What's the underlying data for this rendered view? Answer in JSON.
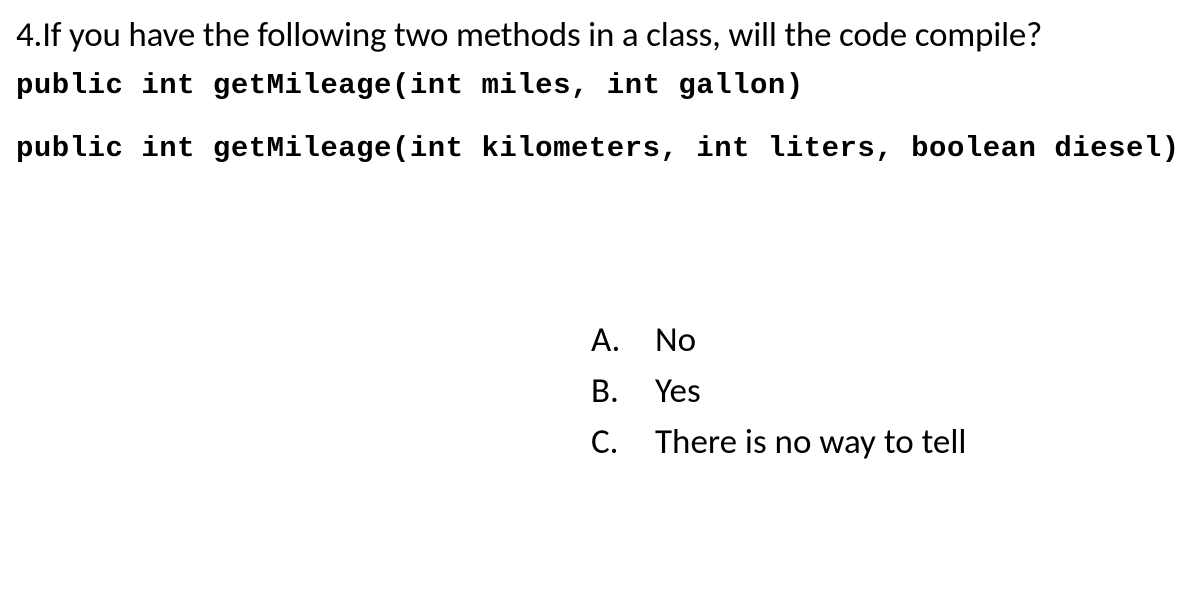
{
  "question": {
    "number": "4.",
    "text": "If you have the following two methods in a class, will the code compile?"
  },
  "code": {
    "line1": "public int getMileage(int miles, int gallon)",
    "line2": "public int getMileage(int kilometers, int liters, boolean diesel)"
  },
  "answers": [
    {
      "label": "A.",
      "text": "No"
    },
    {
      "label": "B.",
      "text": "Yes"
    },
    {
      "label": "C.",
      "text": "There is no way to tell"
    }
  ]
}
